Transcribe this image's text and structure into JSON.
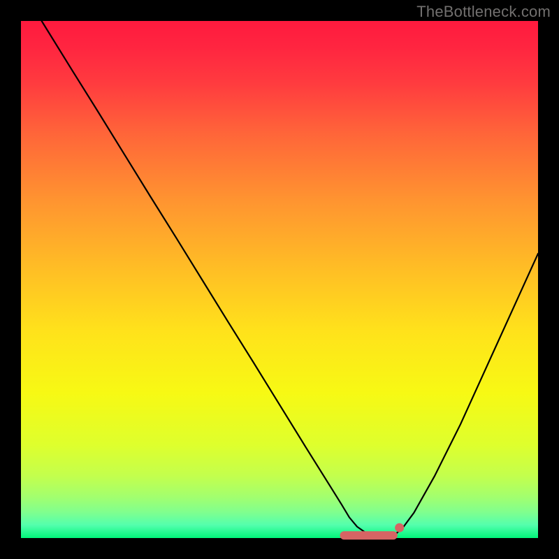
{
  "watermark": "TheBottleneck.com",
  "chart_data": {
    "type": "line",
    "title": "",
    "xlabel": "",
    "ylabel": "",
    "xlim": [
      0,
      100
    ],
    "ylim": [
      0,
      100
    ],
    "x": [
      4,
      10,
      15,
      20,
      25,
      30,
      35,
      40,
      45,
      50,
      55,
      60,
      62,
      63.5,
      65,
      67,
      69,
      71,
      72.5,
      74,
      76,
      80,
      85,
      90,
      95,
      100
    ],
    "values": [
      100,
      90.3,
      82.3,
      74.2,
      66.1,
      58.1,
      50,
      41.9,
      33.9,
      25.8,
      17.7,
      9.7,
      6.5,
      4,
      2.2,
      0.8,
      0.25,
      0.25,
      0.8,
      2.2,
      4.9,
      12,
      22,
      33,
      44,
      55
    ],
    "marker_region": {
      "x_start": 62.5,
      "x_end": 72,
      "y": 0.5
    },
    "background_gradient": {
      "type": "vertical",
      "stops": [
        {
          "offset": 0.0,
          "color": "#ff1a3e"
        },
        {
          "offset": 0.05,
          "color": "#ff2540"
        },
        {
          "offset": 0.12,
          "color": "#ff3b3f"
        },
        {
          "offset": 0.22,
          "color": "#ff6639"
        },
        {
          "offset": 0.35,
          "color": "#ff9530"
        },
        {
          "offset": 0.48,
          "color": "#ffbe25"
        },
        {
          "offset": 0.6,
          "color": "#ffe21b"
        },
        {
          "offset": 0.72,
          "color": "#f7f914"
        },
        {
          "offset": 0.82,
          "color": "#deff2d"
        },
        {
          "offset": 0.88,
          "color": "#c3ff4d"
        },
        {
          "offset": 0.92,
          "color": "#a3ff6e"
        },
        {
          "offset": 0.95,
          "color": "#80ff8e"
        },
        {
          "offset": 0.975,
          "color": "#53ffad"
        },
        {
          "offset": 1.0,
          "color": "#01f57a"
        }
      ]
    }
  }
}
